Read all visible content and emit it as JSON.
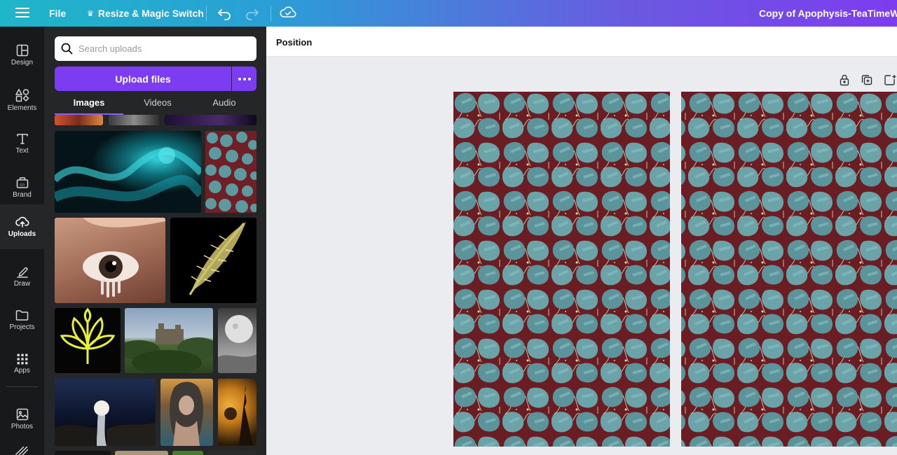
{
  "topbar": {
    "file_label": "File",
    "resize_label": "Resize & Magic Switch",
    "doc_title": "Copy of Apophysis-TeaTimeWithA"
  },
  "leftnav": {
    "items": [
      {
        "label": "Design",
        "icon": "design-icon"
      },
      {
        "label": "Elements",
        "icon": "elements-icon"
      },
      {
        "label": "Text",
        "icon": "text-icon"
      },
      {
        "label": "Brand",
        "icon": "brand-icon"
      },
      {
        "label": "Uploads",
        "icon": "upload-cloud-icon",
        "active": true
      },
      {
        "label": "Draw",
        "icon": "draw-icon"
      },
      {
        "label": "Projects",
        "icon": "folder-icon"
      },
      {
        "label": "Apps",
        "icon": "apps-grid-icon"
      },
      {
        "label": "Photos",
        "icon": "photo-icon"
      }
    ]
  },
  "uploads": {
    "search_placeholder": "Search uploads",
    "upload_label": "Upload files",
    "tabs": [
      {
        "label": "Images",
        "active": true
      },
      {
        "label": "Videos"
      },
      {
        "label": "Audio"
      }
    ]
  },
  "context_toolbar": {
    "position_label": "Position"
  },
  "colors": {
    "accent": "#7c3cf2",
    "panel_bg": "#252627",
    "nav_bg": "#18191b",
    "canvas_bg": "#ebecf0"
  }
}
